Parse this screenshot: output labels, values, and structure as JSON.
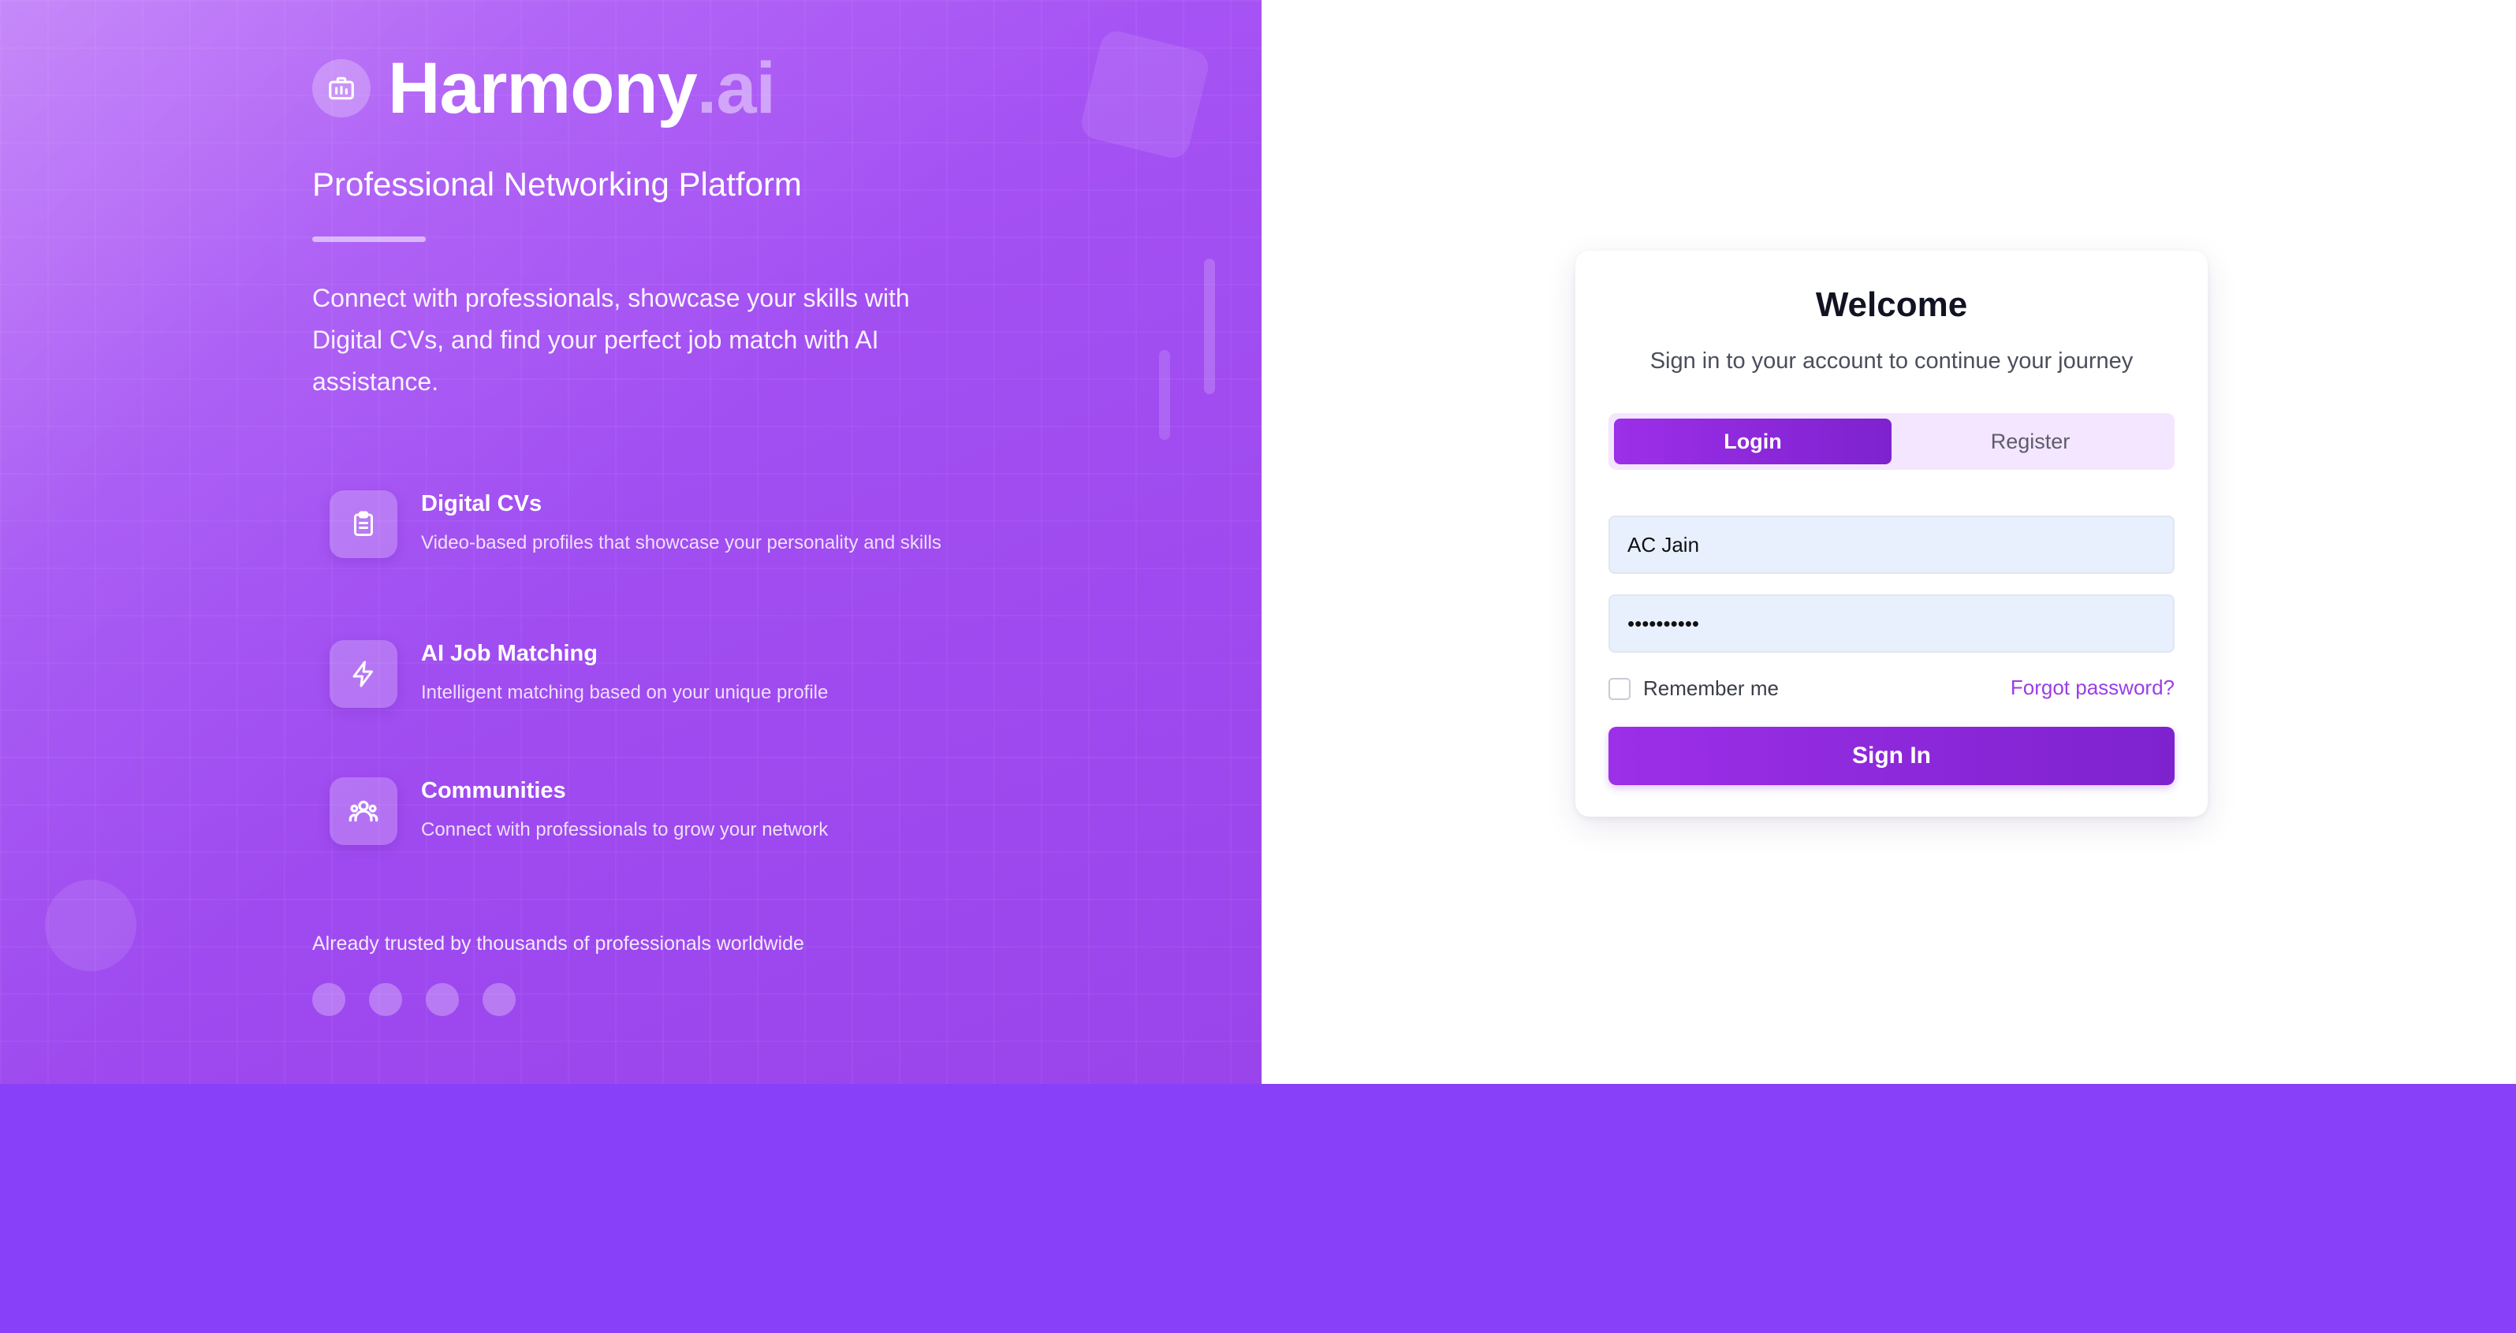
{
  "brand": {
    "name": "Harmony",
    "suffix": ".ai",
    "tagline": "Professional Networking Platform",
    "description": "Connect with professionals, showcase your skills with Digital CVs, and find your perfect job match with AI assistance.",
    "logo_icon": "briefcase-icon"
  },
  "features": [
    {
      "icon": "clipboard-icon",
      "title": "Digital CVs",
      "description": "Video-based profiles that showcase your personality and skills"
    },
    {
      "icon": "lightning-icon",
      "title": "AI Job Matching",
      "description": "Intelligent matching based on your unique profile"
    },
    {
      "icon": "users-icon",
      "title": "Communities",
      "description": "Connect with professionals to grow your network"
    }
  ],
  "trusted_text": "Already trusted by thousands of professionals worldwide",
  "auth": {
    "title": "Welcome",
    "subtitle": "Sign in to your account to continue your journey",
    "tabs": [
      {
        "label": "Login",
        "active": true
      },
      {
        "label": "Register",
        "active": false
      }
    ],
    "username_value": "AC Jain",
    "password_value": "••••••••••",
    "remember_label": "Remember me",
    "remember_checked": false,
    "forgot_label": "Forgot password?",
    "submit_label": "Sign In"
  },
  "colors": {
    "accent": "#7e22ce",
    "hero_gradient_start": "#b05cf7",
    "hero_gradient_end": "#9a44ec",
    "page_background": "#8840f8",
    "link": "#9b3de8",
    "input_background": "#e8f0fe"
  }
}
